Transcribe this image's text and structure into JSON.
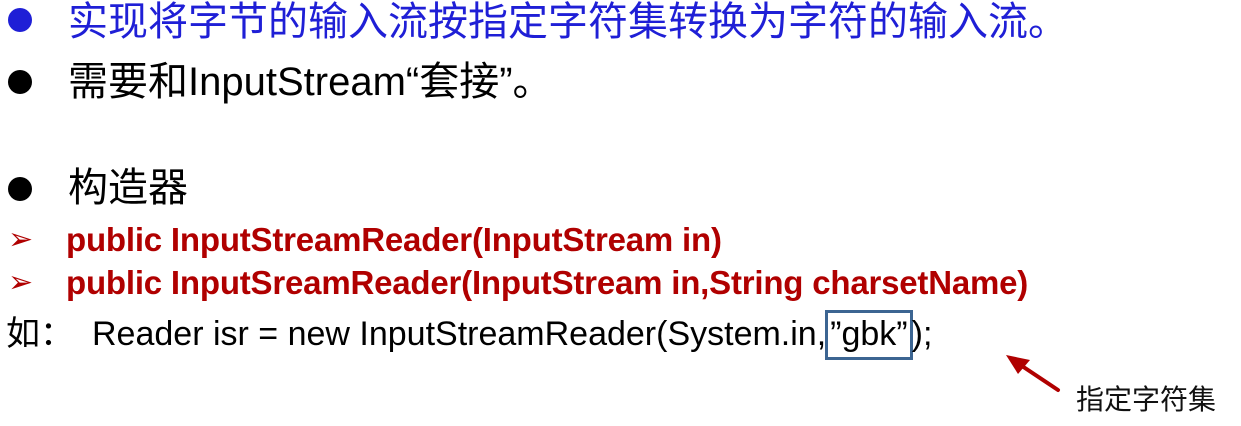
{
  "bullets": [
    {
      "text": "实现将字节的输入流按指定字符集转换为字符的输入流。",
      "color": "#1f1fd6"
    },
    {
      "text": "需要和InputStream“套接”。",
      "color": "#000000"
    },
    {
      "text": "构造器",
      "color": "#000000"
    }
  ],
  "constructors": [
    {
      "marker": "➢",
      "code": "public InputStreamReader(InputStream in)"
    },
    {
      "marker": "➢",
      "code": "public InputSreamReader(InputStream in,String charsetName)"
    }
  ],
  "example": {
    "prefix": "如：",
    "code_before": "Reader isr = new InputStreamReader(System.in,",
    "highlighted": "”gbk”",
    "code_after": ");"
  },
  "annotation": {
    "label": "指定字符集",
    "arrow_color": "#b00000",
    "box_color": "#3c6592"
  }
}
